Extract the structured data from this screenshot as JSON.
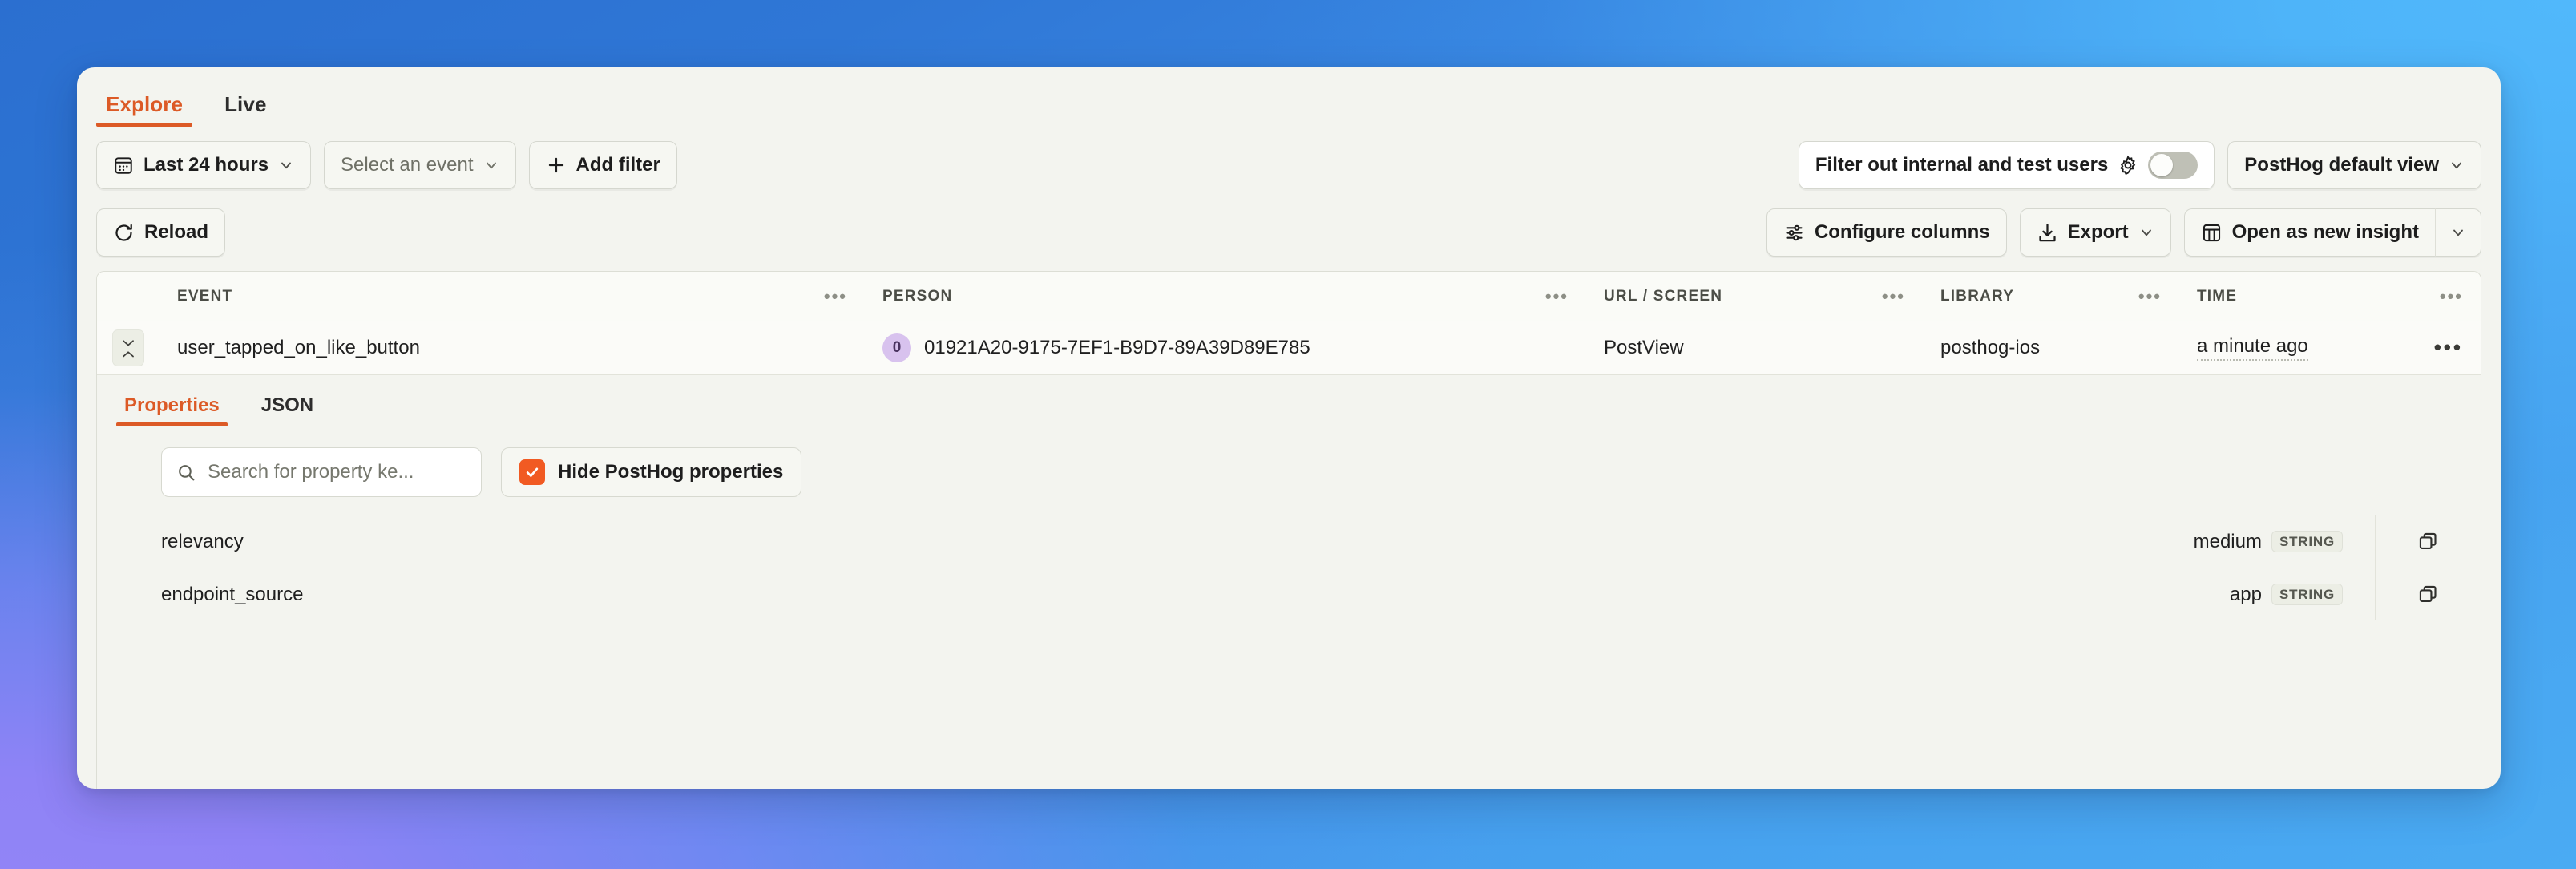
{
  "theme": {
    "accent": "#dc5a26",
    "checkbox_fill": "#f15a22",
    "card_bg": "#f3f4ef",
    "avatar_bg": "#d8c2ee",
    "bg_top_left": "#2b6fd0",
    "bg_top_right": "#4eb4f9",
    "bg_bottom_left": "#8f83f6",
    "bg_bottom_right": "#4aabf3"
  },
  "top_tabs": [
    {
      "label": "Explore",
      "active": true
    },
    {
      "label": "Live",
      "active": false
    }
  ],
  "filter_bar": {
    "date_range": {
      "label": "Last 24 hours",
      "icon": "calendar-icon",
      "caret": "chevron-down-icon"
    },
    "event_select": {
      "label": "Select an event",
      "caret": "chevron-down-icon"
    },
    "add_filter": {
      "label": "Add filter",
      "icon": "plus-icon"
    },
    "internal_users": {
      "label": "Filter out internal and test users",
      "gear_icon": "gear-icon",
      "toggle_on": false
    },
    "view_select": {
      "label": "PostHog default view",
      "caret": "chevron-down-icon"
    }
  },
  "action_bar": {
    "reload": {
      "label": "Reload",
      "icon": "refresh-icon"
    },
    "configure_columns": {
      "label": "Configure columns",
      "icon": "sliders-icon"
    },
    "export": {
      "label": "Export",
      "icon": "download-icon",
      "caret": "chevron-down-icon"
    },
    "open_insight": {
      "label": "Open as new insight",
      "icon": "table-icon",
      "caret": "chevron-down-icon"
    }
  },
  "table": {
    "columns": [
      {
        "key": "event",
        "label": "EVENT",
        "menu": "•••"
      },
      {
        "key": "person",
        "label": "PERSON",
        "menu": "•••"
      },
      {
        "key": "url",
        "label": "URL / SCREEN",
        "menu": "•••"
      },
      {
        "key": "library",
        "label": "LIBRARY",
        "menu": "•••"
      },
      {
        "key": "time",
        "label": "TIME",
        "menu": "•••"
      }
    ],
    "rows": [
      {
        "expanded": true,
        "event": "user_tapped_on_like_button",
        "person_initial": "0",
        "person": "01921A20-9175-7EF1-B9D7-89A39D89E785",
        "url": "PostView",
        "library": "posthog-ios",
        "time": "a minute ago",
        "row_menu": "•••"
      }
    ]
  },
  "detail": {
    "tabs": [
      {
        "label": "Properties",
        "active": true
      },
      {
        "label": "JSON",
        "active": false
      }
    ],
    "search": {
      "placeholder": "Search for property ke...",
      "value": "",
      "icon": "search-icon"
    },
    "hide_posthog": {
      "label": "Hide PostHog properties",
      "checked": true
    },
    "properties": [
      {
        "key": "relevancy",
        "value": "medium",
        "type": "STRING",
        "copy_icon": "copy-icon"
      },
      {
        "key": "endpoint_source",
        "value": "app",
        "type": "STRING",
        "copy_icon": "copy-icon"
      }
    ]
  }
}
